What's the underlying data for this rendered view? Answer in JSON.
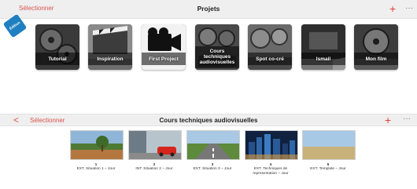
{
  "header": {
    "select_label": "Sélectionner",
    "title": "Projets",
    "add_icon": "+",
    "more_icon": "···"
  },
  "badge": {
    "label": "Édition"
  },
  "projects": [
    {
      "label": "Tutorial"
    },
    {
      "label": "Inspiration"
    },
    {
      "label": "First Project"
    },
    {
      "label": "Cours techniques audiovisuelles"
    },
    {
      "label": "Spot co-cré"
    },
    {
      "label": "Ismail"
    },
    {
      "label": "Mon film"
    }
  ],
  "section": {
    "back_icon": "<",
    "select_label": "Sélectionner",
    "title": "Cours techniques audiovisuelles",
    "add_icon": "+",
    "more_icon": "···"
  },
  "scenes": [
    {
      "number": "1",
      "caption": "EXT. Situation 1 – Jour"
    },
    {
      "number": "2",
      "caption": "INT. Situation 2 – Jour"
    },
    {
      "number": "3",
      "caption": "EXT. Situation 3 – Jour"
    },
    {
      "number": "4",
      "caption": "EXT. Techniques de representation – Jour"
    },
    {
      "number": "5",
      "caption": "EXT. Template – Jour"
    }
  ]
}
